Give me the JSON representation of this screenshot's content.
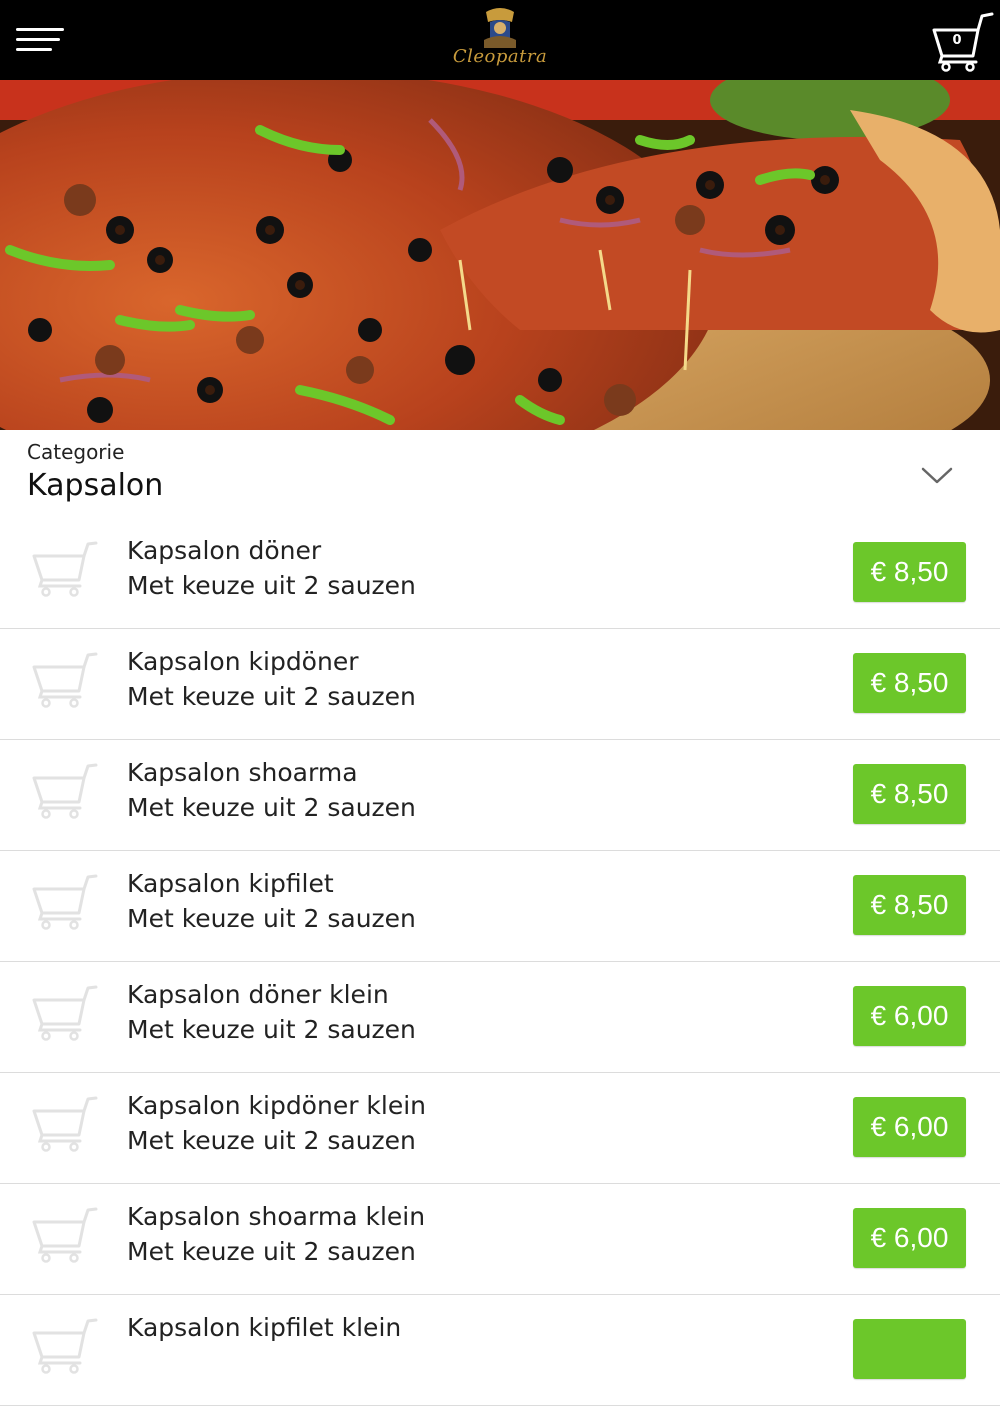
{
  "header": {
    "logo_text": "Cleopatra",
    "cart_count": "0"
  },
  "category": {
    "label": "Categorie",
    "value": "Kapsalon"
  },
  "items": [
    {
      "name": "Kapsalon döner",
      "description": "Met keuze uit 2 sauzen",
      "price": "€ 8,50"
    },
    {
      "name": "Kapsalon kipdöner",
      "description": "Met keuze uit 2 sauzen",
      "price": "€ 8,50"
    },
    {
      "name": "Kapsalon shoarma",
      "description": "Met keuze uit 2 sauzen",
      "price": "€ 8,50"
    },
    {
      "name": "Kapsalon kipfilet",
      "description": "Met keuze uit 2 sauzen",
      "price": "€ 8,50"
    },
    {
      "name": "Kapsalon döner klein",
      "description": "Met keuze uit 2 sauzen",
      "price": "€ 6,00"
    },
    {
      "name": "Kapsalon kipdöner klein",
      "description": "Met keuze uit 2 sauzen",
      "price": "€ 6,00"
    },
    {
      "name": "Kapsalon shoarma klein",
      "description": "Met keuze uit 2 sauzen",
      "price": "€ 6,00"
    },
    {
      "name": "Kapsalon kipfilet klein",
      "description": "",
      "price": ""
    }
  ],
  "colors": {
    "header_bg": "#000000",
    "price_button": "#6cc72a",
    "logo_gold": "#c89b3c"
  },
  "icons": {
    "menu": "hamburger-icon",
    "cart": "shopping-cart-icon",
    "chevron": "chevron-down-icon"
  }
}
